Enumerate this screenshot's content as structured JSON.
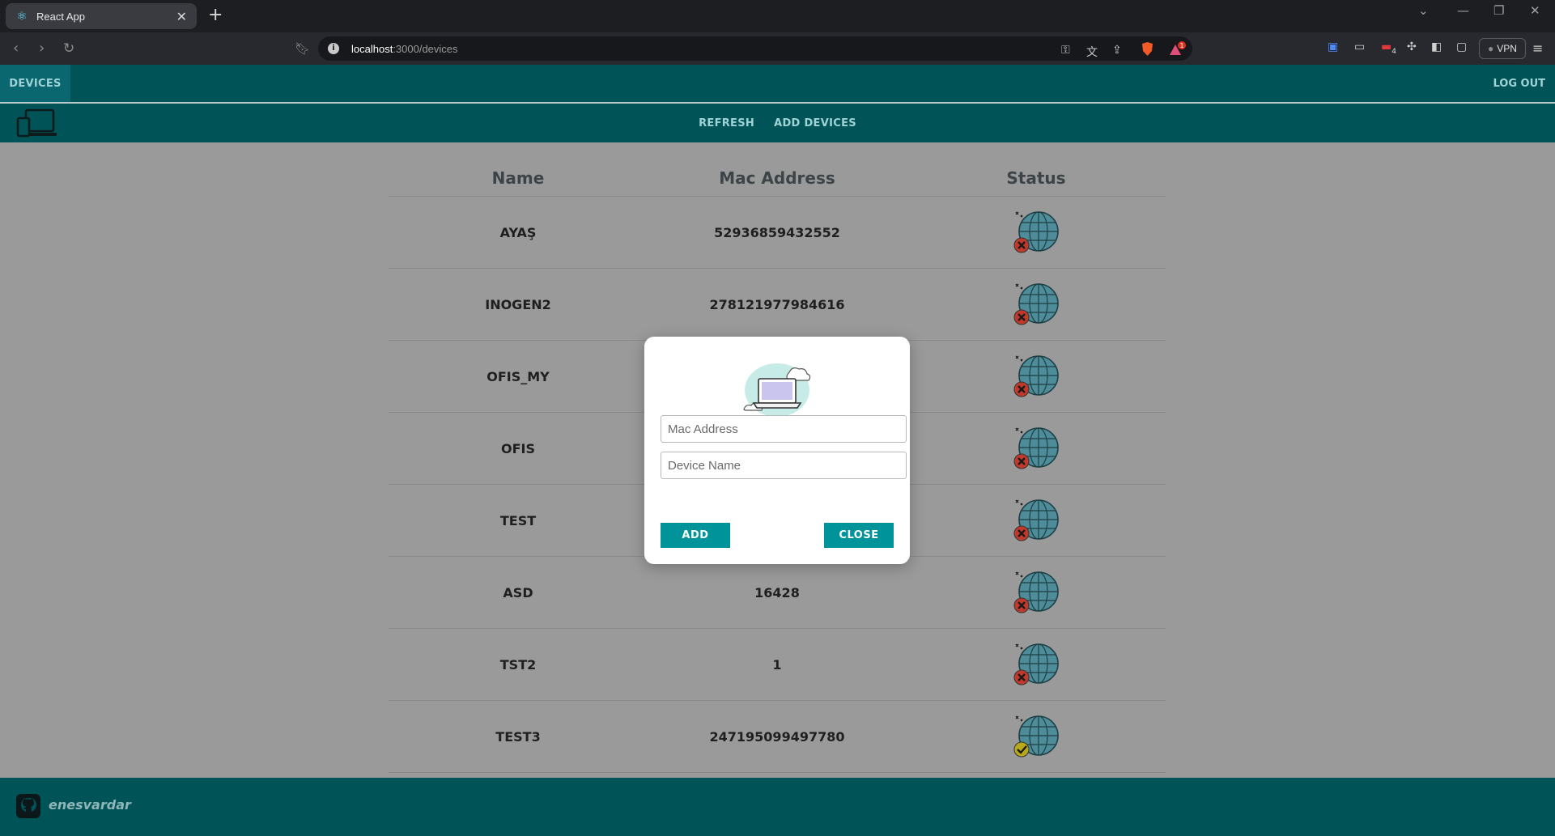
{
  "browser": {
    "tab_title": "React App",
    "new_tab": "+",
    "url_host": "localhost",
    "url_path": ":3000/devices",
    "vpn_label": "VPN",
    "brave_badge": "1",
    "ext_badge": "4"
  },
  "nav": {
    "devices_tab": "DEVICES",
    "logout": "LOG OUT"
  },
  "subnav": {
    "refresh": "REFRESH",
    "add_devices": "ADD DEVICES"
  },
  "table": {
    "headers": [
      "Name",
      "Mac Address",
      "Status"
    ],
    "rows": [
      {
        "name": "AYAŞ",
        "mac": "52936859432552",
        "online": false
      },
      {
        "name": "INOGEN2",
        "mac": "278121977984616",
        "online": false
      },
      {
        "name": "OFIS_MY",
        "mac": "",
        "online": false
      },
      {
        "name": "OFIS",
        "mac": "",
        "online": false
      },
      {
        "name": "TEST",
        "mac": "",
        "online": false
      },
      {
        "name": "ASD",
        "mac": "16428",
        "online": false
      },
      {
        "name": "TST2",
        "mac": "1",
        "online": false
      },
      {
        "name": "TEST3",
        "mac": "247195099497780",
        "online": true
      }
    ]
  },
  "modal": {
    "mac_placeholder": "Mac Address",
    "name_placeholder": "Device Name",
    "add_button": "ADD",
    "close_button": "CLOSE"
  },
  "footer": {
    "github_user": "enesvardar"
  },
  "colors": {
    "teal_dark": "#005356",
    "teal_button": "#00949a",
    "offline": "#c0392b",
    "online": "#b7a91a"
  }
}
